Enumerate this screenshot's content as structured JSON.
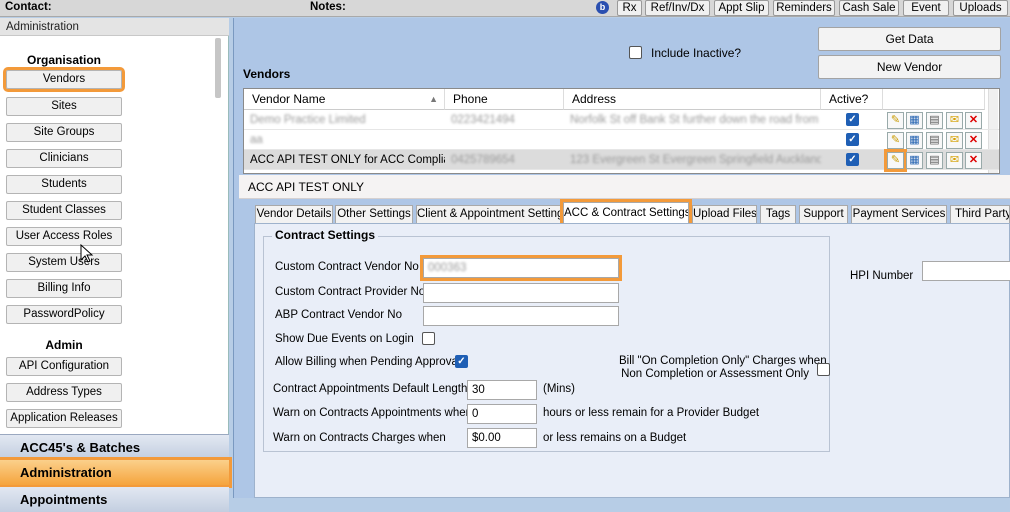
{
  "topbar": {
    "contact_label": "Contact:",
    "notes_label": "Notes:",
    "info_icon": "b",
    "buttons": [
      "Rx",
      "Ref/Inv/Dx",
      "Appt Slip",
      "Reminders",
      "Cash Sale",
      "Event",
      "Uploads"
    ]
  },
  "sidebar": {
    "header": "Administration",
    "sections": {
      "organisation": "Organisation",
      "admin": "Admin"
    },
    "org_items": [
      "Vendors",
      "Sites",
      "Site Groups",
      "Clinicians",
      "Students",
      "Student Classes",
      "User Access Roles",
      "System Users",
      "Billing Info",
      "PasswordPolicy"
    ],
    "admin_items": [
      "API Configuration",
      "Address Types",
      "Application Releases"
    ],
    "bands": [
      "ACC45's & Batches",
      "Administration",
      "Appointments"
    ]
  },
  "vendors": {
    "title": "Vendors",
    "include_inactive_label": "Include Inactive?",
    "get_data": "Get Data",
    "new_vendor": "New Vendor",
    "columns": [
      "Vendor Name",
      "Phone",
      "Address",
      "Active?"
    ],
    "rows": [
      {
        "name": "Demo Practice Limited",
        "phone": "0223421494",
        "address": "Norfolk St off Bank St further down the road from ...",
        "blurred": true
      },
      {
        "name": "aa",
        "phone": "",
        "address": "",
        "blurred": true
      },
      {
        "name": "ACC API TEST ONLY for ACC Complia...",
        "phone": "0425789654",
        "address": "123 Evergreen St Evergreen Springfield Auckland ...",
        "blurred": false
      }
    ]
  },
  "detail": {
    "title": "ACC API TEST ONLY",
    "tabs": [
      "Vendor Details",
      "Other Settings",
      "Client & Appointment Settings",
      "ACC & Contract Settings",
      "Upload Files",
      "Tags",
      "Support",
      "Payment Services",
      "Third Party I"
    ],
    "group_title": "Contract Settings",
    "fields": {
      "custom_contract_vendor_no": "Custom Contract Vendor No",
      "custom_contract_vendor_no_value": "000363",
      "custom_contract_provider_no": "Custom Contract Provider  No",
      "abp_contract_vendor_no": "ABP Contract Vendor No",
      "show_due_events": "Show Due Events on Login",
      "allow_billing": "Allow Billing when Pending Approval",
      "bill_on_completion_1": "Bill \"On Completion Only\" Charges when",
      "bill_on_completion_2": "Non Completion or Assessment Only",
      "default_length": "Contract Appointments Default Length",
      "default_length_value": "30",
      "mins": "(Mins)",
      "warn_appts": "Warn on Contracts Appointments when",
      "warn_appts_value": "0",
      "warn_appts_suffix": "hours or less remain for a Provider Budget",
      "warn_charges": "Warn on Contracts Charges when",
      "warn_charges_value": "$0.00",
      "warn_charges_suffix": "or less remains on a Budget",
      "hpi_number": "HPI Number"
    }
  },
  "colors": {
    "highlight": "#f39a3a",
    "panel": "#aec6e6",
    "check": "#1f5fb5"
  }
}
